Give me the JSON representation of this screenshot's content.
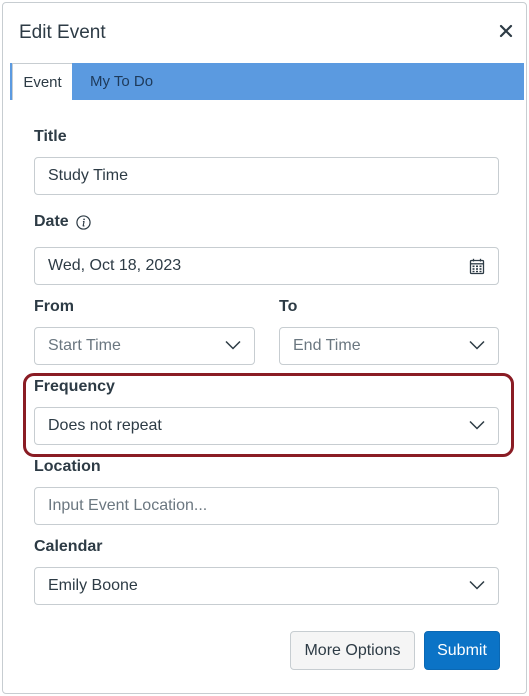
{
  "dialog": {
    "title": "Edit Event",
    "close_icon": "close-icon"
  },
  "tabs": [
    {
      "label": "Event",
      "active": true
    },
    {
      "label": "My To Do",
      "active": false
    }
  ],
  "form": {
    "title": {
      "label": "Title",
      "value": "Study Time"
    },
    "date": {
      "label": "Date",
      "value": "Wed, Oct 18, 2023",
      "info_icon": "info-icon",
      "calendar_icon": "calendar-icon"
    },
    "from": {
      "label": "From",
      "placeholder": "Start Time"
    },
    "to": {
      "label": "To",
      "placeholder": "End Time"
    },
    "frequency": {
      "label": "Frequency",
      "value": "Does not repeat"
    },
    "location": {
      "label": "Location",
      "placeholder": "Input Event Location..."
    },
    "calendar": {
      "label": "Calendar",
      "value": "Emily Boone"
    }
  },
  "actions": {
    "more_options": "More Options",
    "submit": "Submit"
  },
  "colors": {
    "tab_bar": "#5b9ae0",
    "primary_button": "#0b73c6",
    "highlight": "#8a1c24"
  }
}
